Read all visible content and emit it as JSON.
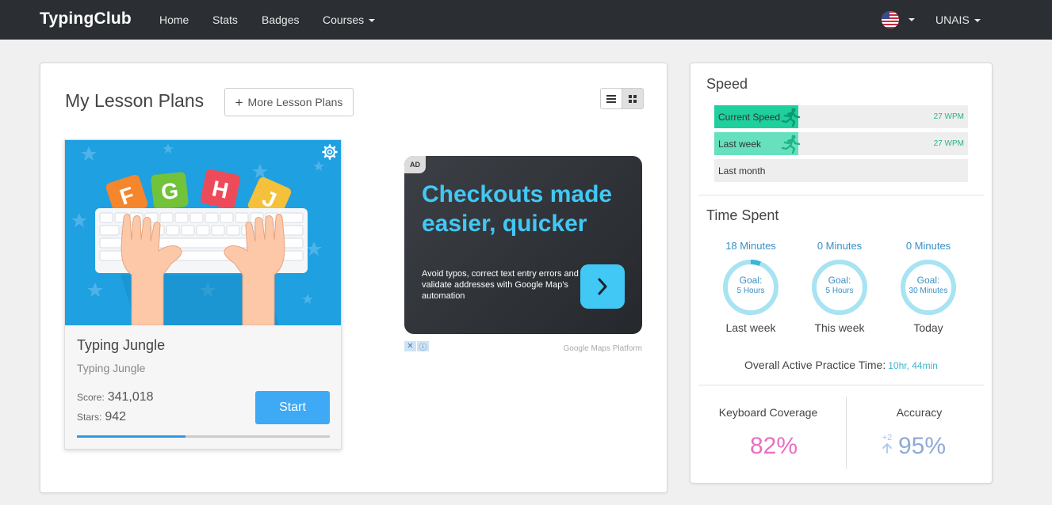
{
  "navbar": {
    "brand": "TypingClub",
    "links": [
      "Home",
      "Stats",
      "Badges",
      "Courses"
    ],
    "user": "UNAIS",
    "flag_icon": "us-flag-icon"
  },
  "lesson_plans": {
    "title": "My Lesson Plans",
    "more_button": "More Lesson Plans",
    "card": {
      "title": "Typing Jungle",
      "subtitle": "Typing Jungle",
      "score_label": "Score:",
      "score": "341,018",
      "stars_label": "Stars:",
      "stars": "942",
      "start_button": "Start",
      "progress": 0.43,
      "image_letters": [
        "F",
        "G",
        "H",
        "J"
      ]
    }
  },
  "ad": {
    "badge": "AD",
    "headline": "Checkouts made easier, quicker",
    "body": "Avoid typos, correct text entry errors and validate addresses with Google Map's automation",
    "source": "Google Maps Platform"
  },
  "speed": {
    "title": "Speed",
    "rows": [
      {
        "label": "Current Speed",
        "value": "27 WPM",
        "fill": 0.33
      },
      {
        "label": "Last week",
        "value": "27 WPM",
        "fill": 0.33
      },
      {
        "label": "Last month",
        "value": "",
        "fill": 0
      }
    ]
  },
  "time_spent": {
    "title": "Time Spent",
    "goal_label": "Goal:",
    "items": [
      {
        "amount": "18 Minutes",
        "goal": "5 Hours",
        "period": "Last week",
        "progress": 0.06
      },
      {
        "amount": "0 Minutes",
        "goal": "5 Hours",
        "period": "This week",
        "progress": 0
      },
      {
        "amount": "0 Minutes",
        "goal": "30 Minutes",
        "period": "Today",
        "progress": 0
      }
    ],
    "overall_label": "Overall Active Practice Time:",
    "overall_value": "10hr, 44min"
  },
  "stats": {
    "keyboard_coverage_label": "Keyboard Coverage",
    "keyboard_coverage": "82%",
    "accuracy_label": "Accuracy",
    "accuracy": "95%",
    "accuracy_delta": "+2"
  },
  "colors": {
    "nav_bg": "#2b2f33",
    "accent_blue": "#3ea9f5",
    "speed_green": "#1fcf9c",
    "ring_light": "#a8e3f2",
    "ring_dark": "#3cb6d8",
    "coverage_pink": "#e86fc3",
    "accuracy_blue": "#8faad6"
  }
}
